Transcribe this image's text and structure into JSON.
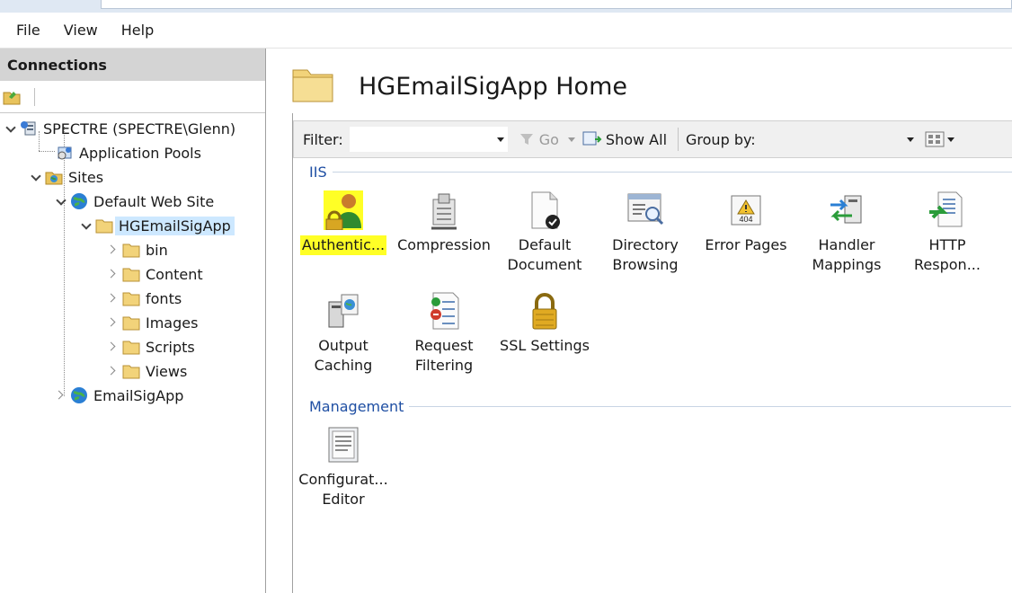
{
  "menu": [
    "File",
    "View",
    "Help"
  ],
  "connections": {
    "header": "Connections",
    "tree": {
      "server": "SPECTRE (SPECTRE\\Glenn)",
      "app_pools": "Application Pools",
      "sites": "Sites",
      "default_site": "Default Web Site",
      "app": "HGEmailSigApp",
      "folders": [
        "bin",
        "Content",
        "fonts",
        "Images",
        "Scripts",
        "Views"
      ],
      "other_site": "EmailSigApp"
    }
  },
  "main": {
    "title": "HGEmailSigApp Home",
    "filter": {
      "label": "Filter:",
      "value": "",
      "go": "Go",
      "show_all": "Show All",
      "group_by": "Group by:"
    },
    "groups": [
      {
        "name": "IIS",
        "features": [
          {
            "label": "Authentic...",
            "icon": "authentication-icon",
            "highlighted": true
          },
          {
            "label": "Compression",
            "icon": "compression-icon"
          },
          {
            "label": "Default Document",
            "icon": "default-document-icon"
          },
          {
            "label": "Directory Browsing",
            "icon": "directory-browsing-icon"
          },
          {
            "label": "Error Pages",
            "icon": "error-pages-icon"
          },
          {
            "label": "Handler Mappings",
            "icon": "handler-mappings-icon"
          },
          {
            "label": "HTTP Respon...",
            "icon": "http-response-headers-icon"
          },
          {
            "label": "Output Caching",
            "icon": "output-caching-icon"
          },
          {
            "label": "Request Filtering",
            "icon": "request-filtering-icon"
          },
          {
            "label": "SSL Settings",
            "icon": "ssl-settings-icon"
          }
        ]
      },
      {
        "name": "Management",
        "features": [
          {
            "label": "Configurat... Editor",
            "icon": "configuration-editor-icon"
          }
        ]
      }
    ]
  },
  "colors": {
    "highlight": "#ffff26",
    "group_header": "#1f4fa3",
    "selection": "#cde8ff",
    "pane_header": "#d4d4d4"
  }
}
